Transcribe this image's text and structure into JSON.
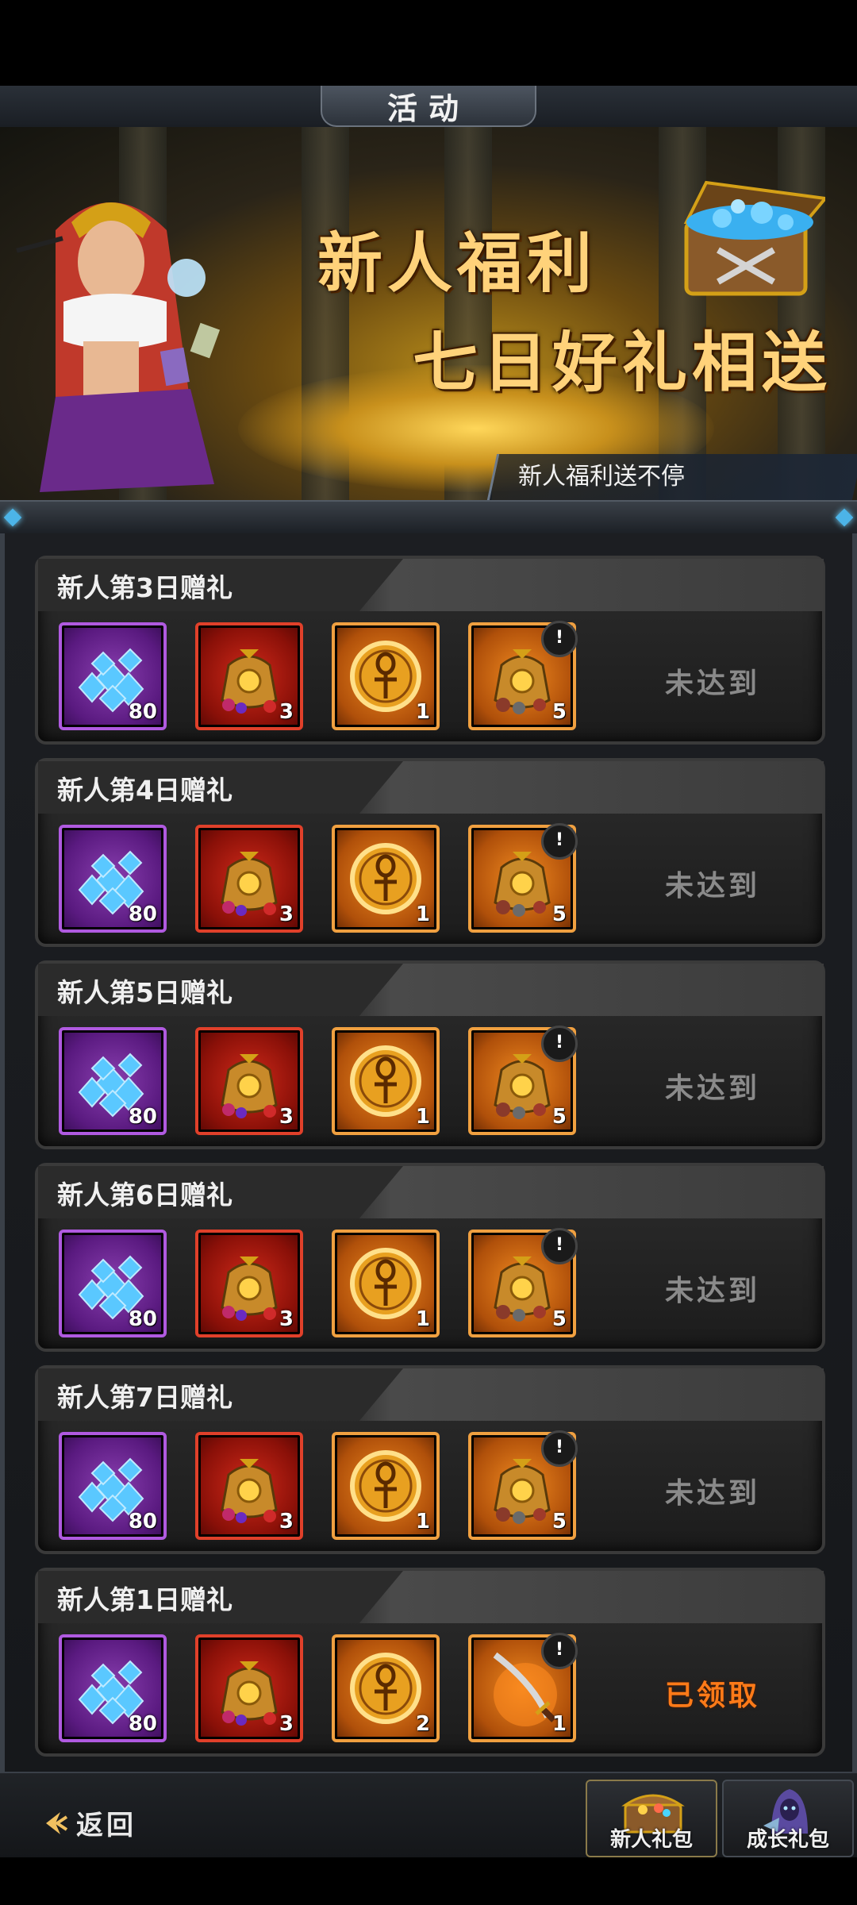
{
  "header": {
    "title": "活动"
  },
  "banner": {
    "headline_1": "新人福利",
    "headline_2": "七日好礼相送",
    "subtitle": "新人福利送不停"
  },
  "gifts": [
    {
      "title": "新人第3日赠礼",
      "items": [
        {
          "kind": "diamond",
          "qty": "80"
        },
        {
          "kind": "loot-bag",
          "qty": "3"
        },
        {
          "kind": "ankh-coin",
          "qty": "1"
        },
        {
          "kind": "loot-bag-orange",
          "qty": "5",
          "badge": "!"
        }
      ],
      "status": "未达到",
      "status_type": "pending"
    },
    {
      "title": "新人第4日赠礼",
      "items": [
        {
          "kind": "diamond",
          "qty": "80"
        },
        {
          "kind": "loot-bag",
          "qty": "3"
        },
        {
          "kind": "ankh-coin",
          "qty": "1"
        },
        {
          "kind": "loot-bag-orange",
          "qty": "5",
          "badge": "!"
        }
      ],
      "status": "未达到",
      "status_type": "pending"
    },
    {
      "title": "新人第5日赠礼",
      "items": [
        {
          "kind": "diamond",
          "qty": "80"
        },
        {
          "kind": "loot-bag",
          "qty": "3"
        },
        {
          "kind": "ankh-coin",
          "qty": "1"
        },
        {
          "kind": "loot-bag-orange",
          "qty": "5",
          "badge": "!"
        }
      ],
      "status": "未达到",
      "status_type": "pending"
    },
    {
      "title": "新人第6日赠礼",
      "items": [
        {
          "kind": "diamond",
          "qty": "80"
        },
        {
          "kind": "loot-bag",
          "qty": "3"
        },
        {
          "kind": "ankh-coin",
          "qty": "1"
        },
        {
          "kind": "loot-bag-orange",
          "qty": "5",
          "badge": "!"
        }
      ],
      "status": "未达到",
      "status_type": "pending"
    },
    {
      "title": "新人第7日赠礼",
      "items": [
        {
          "kind": "diamond",
          "qty": "80"
        },
        {
          "kind": "loot-bag",
          "qty": "3"
        },
        {
          "kind": "ankh-coin",
          "qty": "1"
        },
        {
          "kind": "loot-bag-orange",
          "qty": "5",
          "badge": "!"
        }
      ],
      "status": "未达到",
      "status_type": "pending"
    },
    {
      "title": "新人第1日赠礼",
      "items": [
        {
          "kind": "diamond",
          "qty": "80"
        },
        {
          "kind": "loot-bag",
          "qty": "3"
        },
        {
          "kind": "ankh-coin",
          "qty": "2"
        },
        {
          "kind": "sword",
          "qty": "1",
          "badge": "!"
        }
      ],
      "status": "已领取",
      "status_type": "claimed"
    }
  ],
  "footer": {
    "back_label": "返回",
    "tabs": [
      {
        "label": "新人礼包",
        "icon": "treasure-chest-icon",
        "active": true
      },
      {
        "label": "成长礼包",
        "icon": "hooded-hero-icon",
        "active": false
      }
    ]
  }
}
